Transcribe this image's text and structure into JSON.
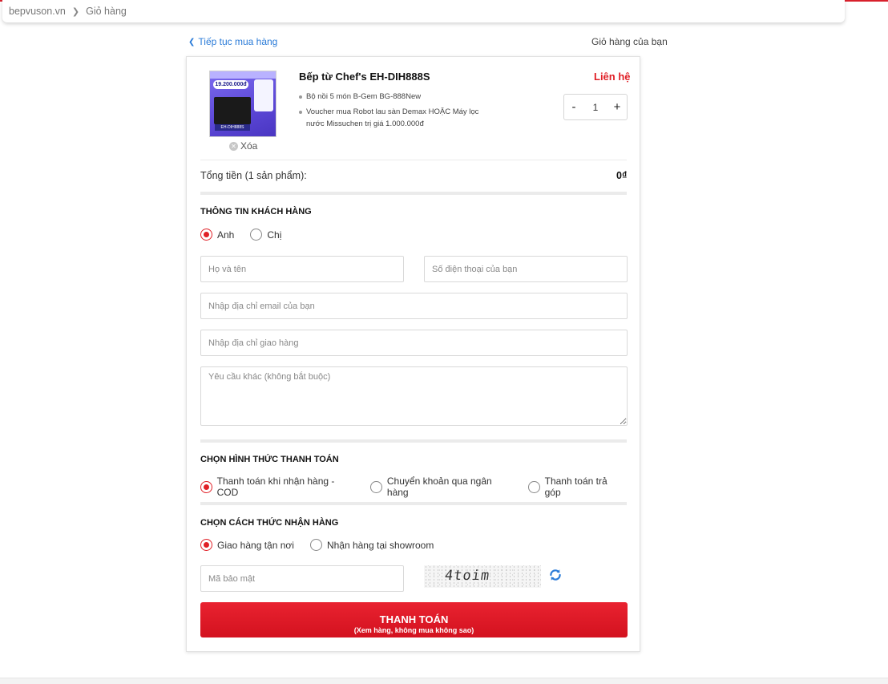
{
  "breadcrumb": {
    "home": "bepvuson.vn",
    "current": "Giỏ hàng"
  },
  "header": {
    "continue_label": "Tiếp tục mua hàng",
    "cart_title": "Giỏ hàng của bạn"
  },
  "product": {
    "name": "Bếp từ Chef's EH-DIH888S",
    "price_label": "Liên hệ",
    "quantity": "1",
    "remove_label": "Xóa",
    "gifts": [
      "Bộ nồi 5 món B-Gem BG-888New",
      "Voucher mua Robot lau sàn Demax HOẶC Máy lọc nước Missuchen trị giá 1.000.000đ"
    ],
    "image_text": {
      "price": "19.200.000đ",
      "model": "EH-DIH888S"
    }
  },
  "total": {
    "label": "Tổng tiền (1 sản phẩm):",
    "value": "0₫"
  },
  "customer": {
    "title": "THÔNG TIN KHÁCH HÀNG",
    "gender_options": [
      "Anh",
      "Chị"
    ],
    "selected_gender": "Anh",
    "name_placeholder": "Họ và tên",
    "phone_placeholder": "Số điện thoại của bạn",
    "email_placeholder": "Nhập địa chỉ email của bạn",
    "address_placeholder": "Nhập địa chỉ giao hàng",
    "note_placeholder": "Yêu cầu khác (không bắt buộc)"
  },
  "payment": {
    "title": "CHỌN HÌNH THỨC THANH TOÁN",
    "options": [
      "Thanh toán khi nhận hàng - COD",
      "Chuyển khoản qua ngân hàng",
      "Thanh toán trả góp"
    ],
    "selected": "Thanh toán khi nhận hàng - COD"
  },
  "delivery": {
    "title": "CHỌN CÁCH THỨC NHẬN HÀNG",
    "options": [
      "Giao hàng tận nơi",
      "Nhận hàng tại showroom"
    ],
    "selected": "Giao hàng tận nơi"
  },
  "captcha": {
    "placeholder": "Mã bảo mật",
    "code": "4toim"
  },
  "submit": {
    "label": "THANH TOÁN",
    "sub_label": "(Xem hàng, không mua không sao)"
  },
  "colors": {
    "accent": "#e01f26",
    "link": "#2a7bd8"
  }
}
